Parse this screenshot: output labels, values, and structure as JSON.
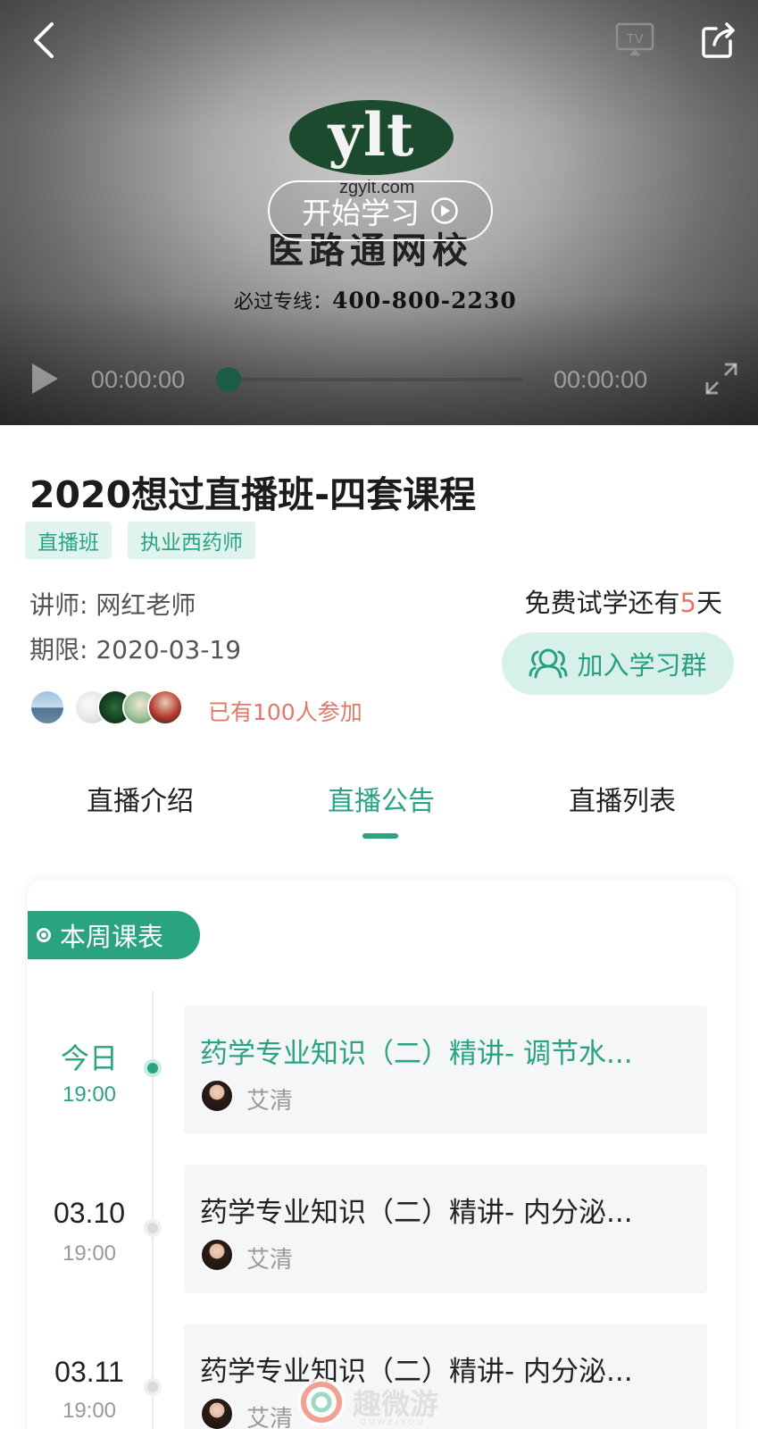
{
  "player": {
    "logo_text": "ylt",
    "logo_domain": "zgylt.com",
    "logo_cn": "医路通网校",
    "hotline_label": "必过专线：",
    "hotline_number": "400-800-2230",
    "start_label": "开始学习",
    "time_current": "00:00:00",
    "time_total": "00:00:00",
    "progress": 0
  },
  "course": {
    "title": "2020想过直播班-四套课程",
    "tags": [
      "直播班",
      "执业西药师"
    ],
    "lecturer": "讲师: 网红老师",
    "deadline": "期限: 2020-03-19",
    "trial_prefix": "免费试学还有",
    "trial_days": "5",
    "trial_suffix": "天",
    "join_group_label": "加入学习群",
    "joined_text": "已有100人参加"
  },
  "tabs": [
    {
      "label": "直播介绍",
      "active": false
    },
    {
      "label": "直播公告",
      "active": true
    },
    {
      "label": "直播列表",
      "active": false
    }
  ],
  "schedule": {
    "badge": "本周课表",
    "items": [
      {
        "date": "今日",
        "time": "19:00",
        "title": "药学专业知识（二）精讲- 调节水...",
        "teacher": "艾清",
        "today": true
      },
      {
        "date": "03.10",
        "time": "19:00",
        "title": "药学专业知识（二）精讲- 内分泌...",
        "teacher": "艾清",
        "today": false
      },
      {
        "date": "03.11",
        "time": "19:00",
        "title": "药学专业知识（二）精讲- 内分泌...",
        "teacher": "艾清",
        "today": false
      }
    ]
  },
  "watermark": {
    "text": "趣微游",
    "sub": "QUWEIYOU"
  },
  "colors": {
    "accent": "#2aa381",
    "accent_light": "#e0f3ee",
    "highlight": "#e0796a"
  }
}
